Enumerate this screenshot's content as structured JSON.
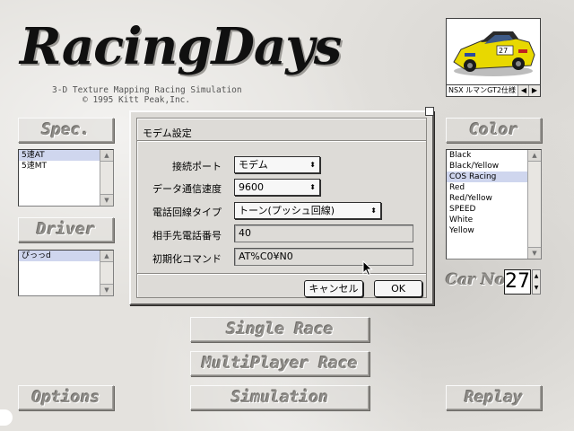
{
  "logo": {
    "title": "RacingDays",
    "subtitle": "3-D Texture Mapping Racing Simulation",
    "copyright": "© 1995 Kitt Peak,Inc."
  },
  "left": {
    "spec_label": "Spec.",
    "spec_items": [
      {
        "label": "5速AT",
        "selected": true
      },
      {
        "label": "5速MT",
        "selected": false
      }
    ],
    "driver_label": "Driver",
    "driver_items": [
      {
        "label": "ぴっっd",
        "selected": true
      }
    ],
    "options_label": "Options"
  },
  "right": {
    "color_label": "Color",
    "colors": [
      "Black",
      "Black/Yellow",
      "COS Racing",
      "Red",
      "Red/Yellow",
      "SPEED",
      "White",
      "Yellow"
    ],
    "selected_color_index": 2,
    "car_name": "NSX ルマンGT2仕様",
    "car_no_label": "Car No.",
    "car_no": "27",
    "replay_label": "Replay"
  },
  "center": {
    "single_race_label": "Single Race",
    "multiplayer_label": "MultiPlayer Race",
    "simulation_label": "Simulation"
  },
  "dialog": {
    "title": "モデム設定",
    "connection_port_label": "接続ポート",
    "connection_port_value": "モデム",
    "speed_label": "データ通信速度",
    "speed_value": "9600",
    "line_type_label": "電話回線タイプ",
    "line_type_value": "トーン(プッシュ回線)",
    "phone_label": "相手先電話番号",
    "phone_value": "40",
    "init_label": "初期化コマンド",
    "init_value": "AT%C0¥N0",
    "cancel_label": "キャンセル",
    "ok_label": "OK"
  }
}
